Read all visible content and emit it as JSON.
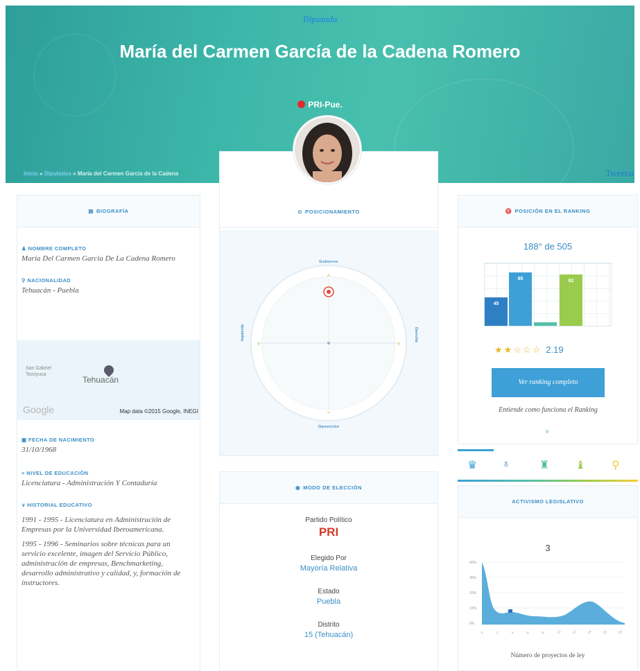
{
  "header": {
    "role": "Diputado",
    "name": "María del Carmen García de la Cadena Romero",
    "party": "PRI-Pue.",
    "breadcrumb": [
      "Inicio",
      "Diputados",
      "María del Carmen García de la Cadena"
    ],
    "breadcrumb_sep": "»",
    "tweet_label": "Tweetar",
    "party_dot_color": "#e02b2b"
  },
  "biography": {
    "title": "Biografía",
    "full_name_label": "Nombre completo",
    "full_name": "Maria Del Carmen Garcia De La Cadena Romero",
    "nationality_label": "Nacionalidad",
    "nationality": "Tehuacán - Puebla",
    "map": {
      "town_small": "San Gabriel Tezoyuca",
      "town": "Tehuacán",
      "logo": "Google",
      "credit": "Map data ©2015 Google, INEGI"
    },
    "birthdate_label": "Fecha de nacimiento",
    "birthdate": "31/10/1968",
    "education_level_label": "Nivel de educación",
    "education_level": "Licenciatura - Administración Y Contaduría",
    "history_label": "Historial educativo",
    "history": [
      "1991 - 1995 - Licenciatura en Administración de Empresas por la Universidad Iberoamericana.",
      "1995 - 1996 - Seminarios sobre técnicas para un servicio excelente, imagen del Servicio Público, administración de empresas, Benchmarketing, desarrollo administrativo y calidad, y, formación de instructores."
    ]
  },
  "positioning": {
    "title": "Posicionamiento",
    "top": "Gobierno",
    "bottom": "Oposición",
    "left": "Izquierda",
    "right": "Derecha"
  },
  "election": {
    "title": "Modo de elección",
    "party_label": "Partido Político",
    "party": "PRI",
    "elected_label": "Elegido Por",
    "elected": "Mayoría Relativa",
    "state_label": "Estado",
    "state": "Puebla",
    "district_label": "Distrito",
    "district": "15 (Tehuacán)"
  },
  "ranking": {
    "title": "Posición en el ranking",
    "position": "188° de 505",
    "bars": [
      {
        "value": 45,
        "color": "#2f7fc4"
      },
      {
        "value": 85,
        "color": "#3ea0d6"
      },
      {
        "value": 5,
        "color": "#53c0a8"
      },
      {
        "value": 82,
        "color": "#9acb4c"
      }
    ],
    "bar_labels": [
      "45",
      "85",
      "",
      "82"
    ],
    "stars": "★★☆☆☆",
    "score": "2.19",
    "rating": 2.19,
    "button": "Ver ranking completo",
    "explain": "Entiende como funciona el Ranking"
  },
  "tabs": {
    "icons": [
      "medal-icon",
      "money-icon",
      "lamp-icon",
      "trophy-icon",
      "search-icon"
    ],
    "colors": [
      "#3ea0d6",
      "#2f7fc4",
      "#53c0a8",
      "#9acb4c",
      "#f2cc3a"
    ]
  },
  "activity": {
    "title": "Activismo legislativo",
    "count": "3",
    "xlabel": "Número de proyectos de ley",
    "yticks": [
      "40%",
      "30%",
      "20%",
      "10%",
      "0%"
    ],
    "xticks": [
      "0",
      "2",
      "4",
      "6",
      "8",
      "10",
      "12",
      "14",
      "16",
      "18"
    ]
  }
}
